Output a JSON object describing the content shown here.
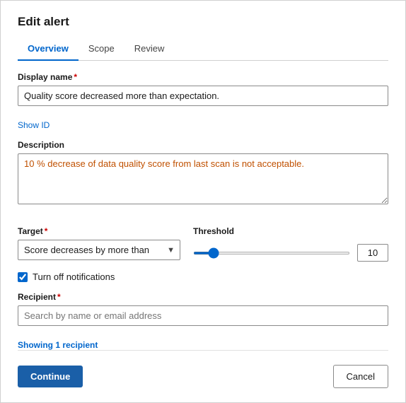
{
  "dialog": {
    "title": "Edit alert",
    "tabs": [
      {
        "label": "Overview",
        "active": true
      },
      {
        "label": "Scope",
        "active": false
      },
      {
        "label": "Review",
        "active": false
      }
    ],
    "display_name_label": "Display name",
    "display_name_value": "Quality score decreased more than expectation.",
    "show_id_link": "Show ID",
    "description_label": "Description",
    "description_value": "10 % decrease of data quality score from last scan is not acceptable.",
    "target_label": "Target",
    "target_value": "Score decreases by more than",
    "threshold_label": "Threshold",
    "threshold_value": "10",
    "slider_value": 10,
    "notifications_label": "Turn off notifications",
    "recipient_label": "Recipient",
    "recipient_placeholder": "Search by name or email address",
    "showing_text": "Showing ",
    "showing_count": "1",
    "showing_suffix": " recipient",
    "footer": {
      "continue_label": "Continue",
      "cancel_label": "Cancel"
    }
  }
}
